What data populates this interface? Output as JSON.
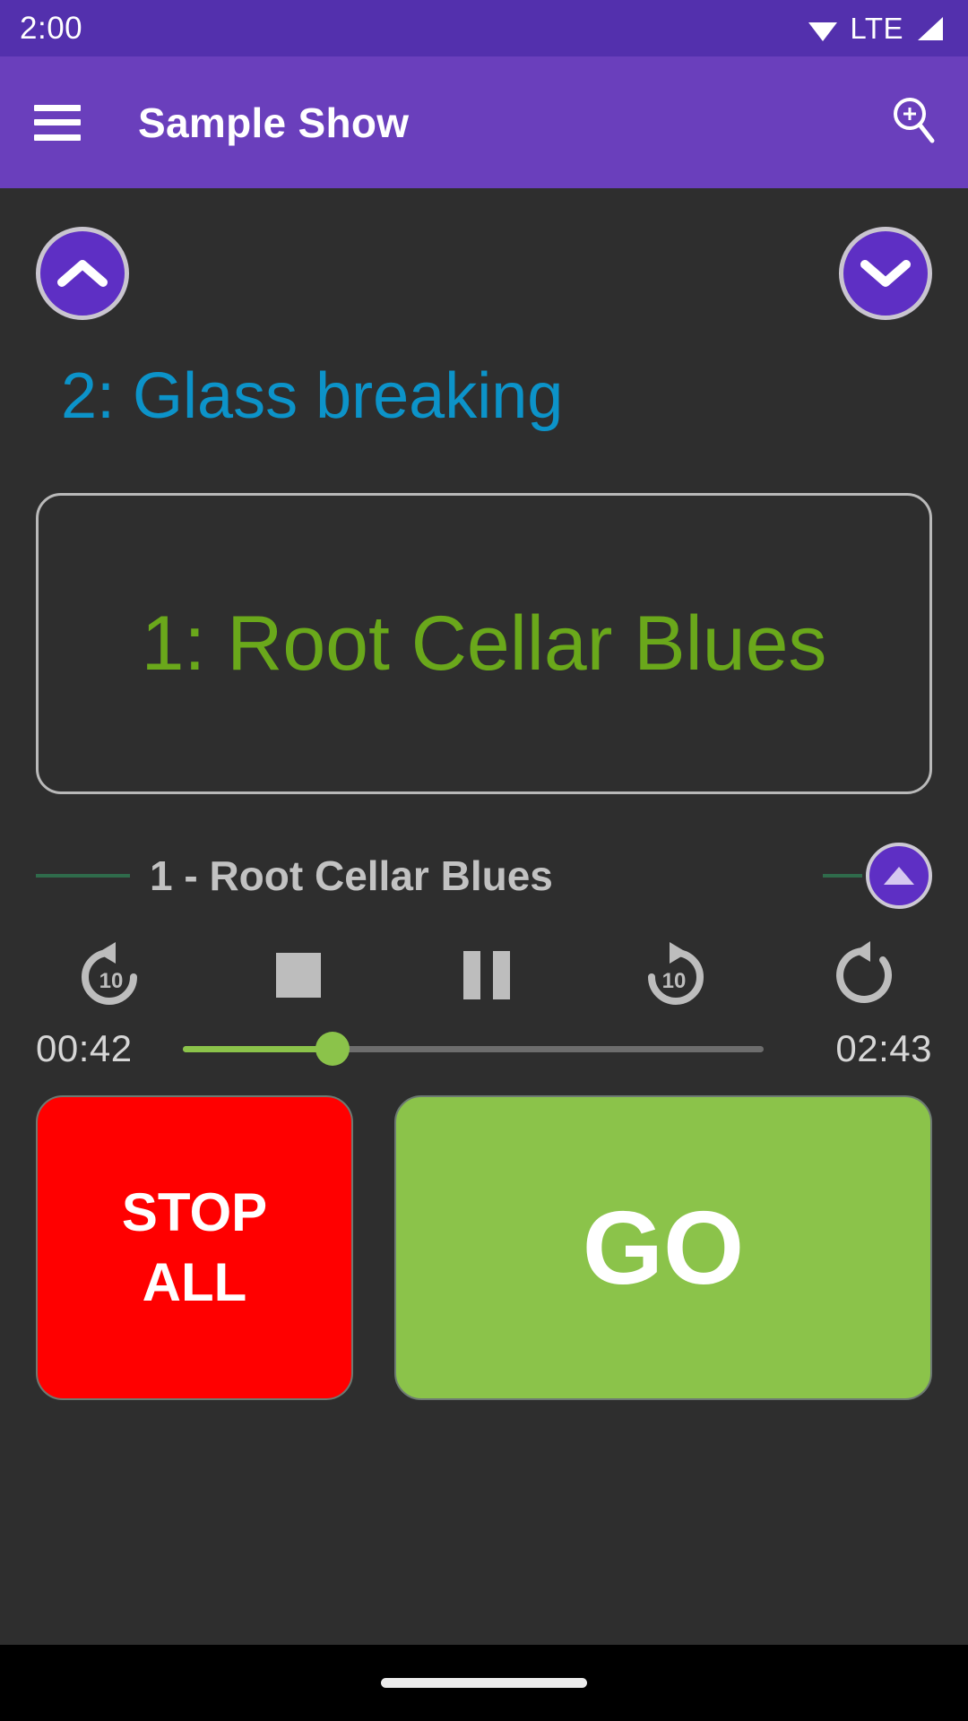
{
  "status_bar": {
    "clock": "2:00",
    "network_label": "LTE",
    "wifi_icon": "wifi-icon",
    "signal_icon": "signal-bars-icon"
  },
  "app_bar": {
    "menu_icon": "hamburger-menu-icon",
    "title": "Sample Show",
    "search_icon": "zoom-in-search-icon"
  },
  "navigation": {
    "up_icon": "chevron-up-icon",
    "down_icon": "chevron-down-icon"
  },
  "cues": {
    "next_cue_label": "2: Glass breaking",
    "next_cue_color": "#0c93c9",
    "current_cue_label": "1: Root Cellar Blues",
    "current_cue_color": "#6aa81b"
  },
  "track": {
    "title": "1 - Root Cellar Blues",
    "expand_icon": "triangle-up-icon",
    "rule_color": "#2f6b4b"
  },
  "transport": {
    "replay10_icon": "replay-10-icon",
    "replay10_label": "10",
    "stop_icon": "stop-icon",
    "pause_icon": "pause-icon",
    "forward10_icon": "forward-10-icon",
    "forward10_label": "10",
    "loop_icon": "loop-repeat-icon"
  },
  "progress": {
    "elapsed": "00:42",
    "duration": "02:43",
    "percent": 25.8,
    "fill_color": "#8bc34a",
    "track_color": "#6d6d6d"
  },
  "actions": {
    "stop_all_label": "STOP\nALL",
    "stop_all_color": "#ff0000",
    "go_label": "GO",
    "go_color": "#8bc34a"
  },
  "system_nav": {
    "gesture_pill": "gesture-home-pill"
  },
  "theme": {
    "status_bar_color": "#5330ad",
    "app_bar_color": "#6a3fbc",
    "background_color": "#2e2e2e",
    "accent_purple": "#5e2fc4"
  }
}
